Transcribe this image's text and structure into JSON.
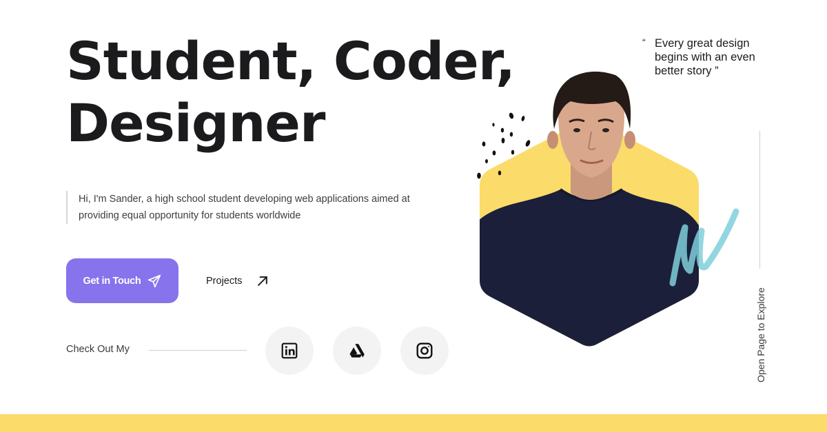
{
  "hero": {
    "headline_line1": "Student, Coder,",
    "headline_line2": "Designer",
    "intro": "Hi, I'm Sander, a high school student developing web applications aimed at providing equal opportunity for students worldwide"
  },
  "actions": {
    "cta_label": "Get in Touch",
    "cta_icon": "paper-plane-icon",
    "projects_label": "Projects",
    "projects_icon": "arrow-up-right-icon"
  },
  "social": {
    "label": "Check Out My",
    "links": [
      {
        "icon": "linkedin-icon"
      },
      {
        "icon": "artstation-icon"
      },
      {
        "icon": "instagram-icon"
      }
    ]
  },
  "quote": {
    "open": "“",
    "text": "Every great design begins with an even better story ”"
  },
  "side": {
    "explore_label": "Open Page to Explore"
  },
  "colors": {
    "accent": "#8773ec",
    "yellow": "#fbdb6a",
    "teal_scribble": "#7fcfda",
    "shirt": "#1b1f3a",
    "text": "#1c1c1e"
  }
}
